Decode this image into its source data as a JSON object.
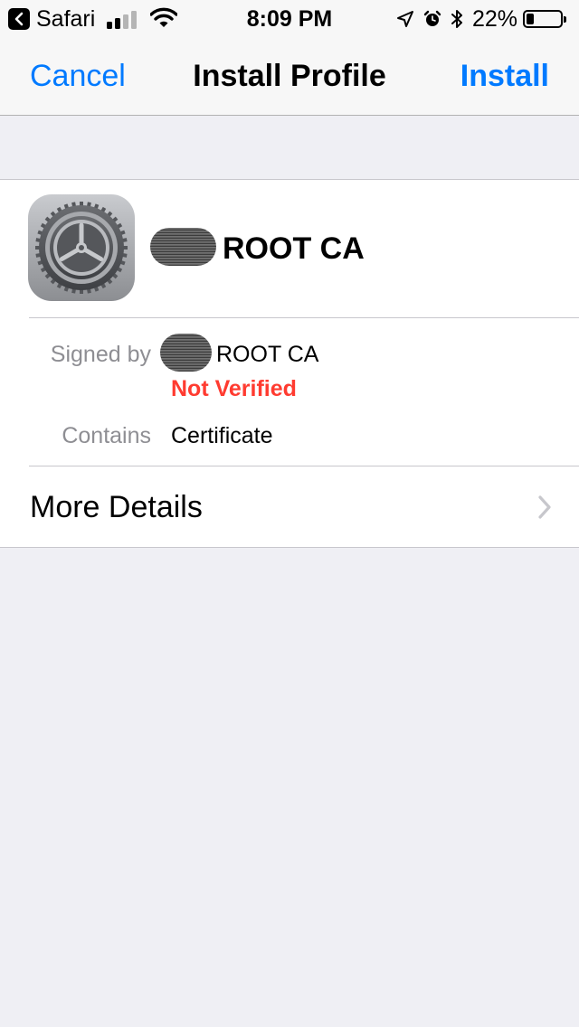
{
  "status_bar": {
    "back_app": "Safari",
    "time": "8:09 PM",
    "battery_percent": "22%",
    "battery_level": 0.22,
    "signal_bars_filled": 2,
    "signal_bars_total": 4,
    "icons": [
      "back-arrow-icon",
      "signal-bars-icon",
      "wifi-icon",
      "location-arrow-icon",
      "alarm-clock-icon",
      "bluetooth-icon",
      "battery-icon"
    ]
  },
  "nav_bar": {
    "cancel_label": "Cancel",
    "title": "Install Profile",
    "install_label": "Install"
  },
  "profile": {
    "icon": "settings-gear-icon",
    "name": "ROOT CA",
    "signed_by_label": "Signed by",
    "signed_by_value": "ROOT CA",
    "verification_status": "Not Verified",
    "contains_label": "Contains",
    "contains_value": "Certificate"
  },
  "more_details": {
    "label": "More Details",
    "icon": "chevron-right-icon"
  },
  "colors": {
    "accent": "#007aff",
    "warning": "#ff3b30",
    "background": "#efeff4",
    "secondary_text": "#8e8e93"
  }
}
